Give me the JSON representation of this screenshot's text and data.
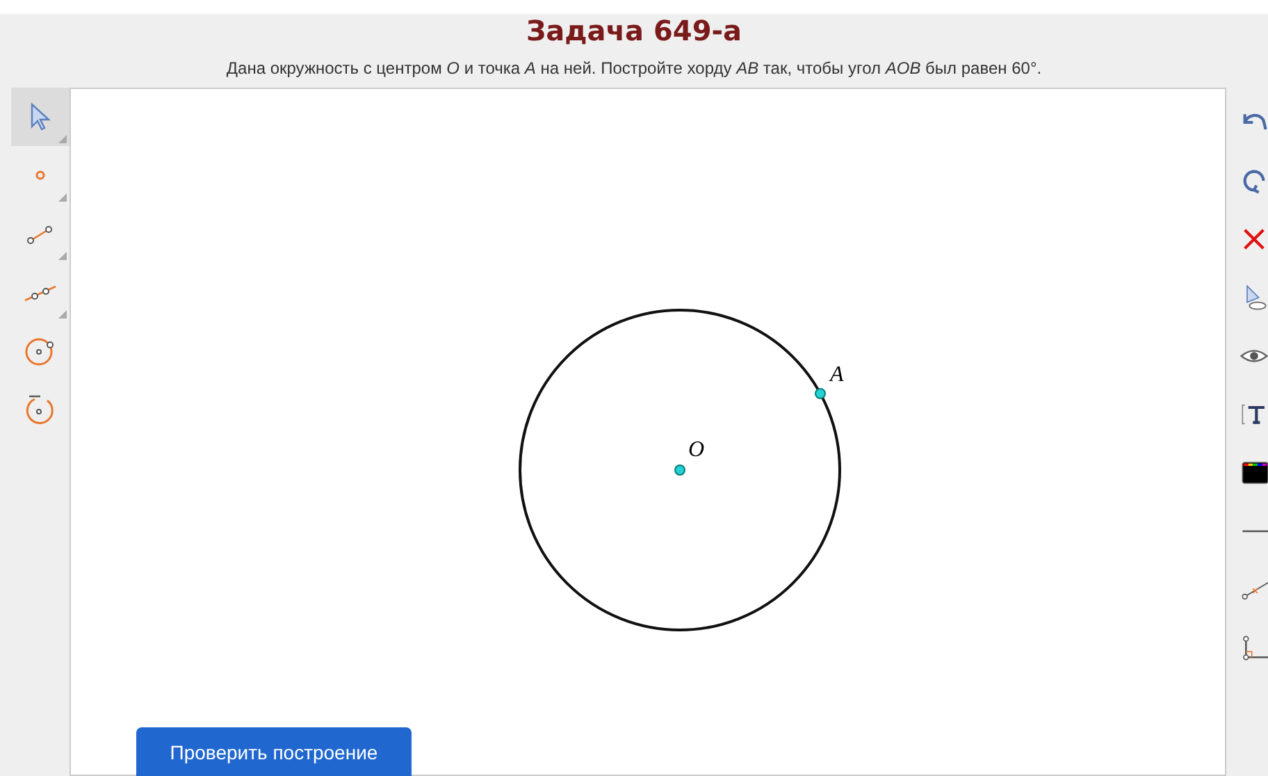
{
  "title": "Задача 649-а",
  "description": "Дана окружность с центром *O* и точка *A* на ней. Постройте хорду *AB* так, чтобы угол *AOB* был равен 60°.",
  "left_tools": [
    {
      "kind": "pointer",
      "selected": true
    },
    {
      "kind": "point",
      "selected": false
    },
    {
      "kind": "segment",
      "selected": false
    },
    {
      "kind": "line",
      "selected": false
    },
    {
      "kind": "circle",
      "selected": false
    },
    {
      "kind": "compass",
      "selected": false
    }
  ],
  "right_tools": [
    {
      "kind": "undo"
    },
    {
      "kind": "redo"
    },
    {
      "kind": "delete"
    },
    {
      "kind": "show-hide"
    },
    {
      "kind": "eye"
    },
    {
      "kind": "text"
    },
    {
      "kind": "color"
    },
    {
      "kind": "line-style"
    },
    {
      "kind": "midpoint"
    },
    {
      "kind": "perpendicular"
    }
  ],
  "canvas": {
    "points": [
      {
        "label": "O",
        "kind": "center"
      },
      {
        "label": "A",
        "kind": "on-circle"
      }
    ]
  },
  "check_button": "Проверить построение"
}
